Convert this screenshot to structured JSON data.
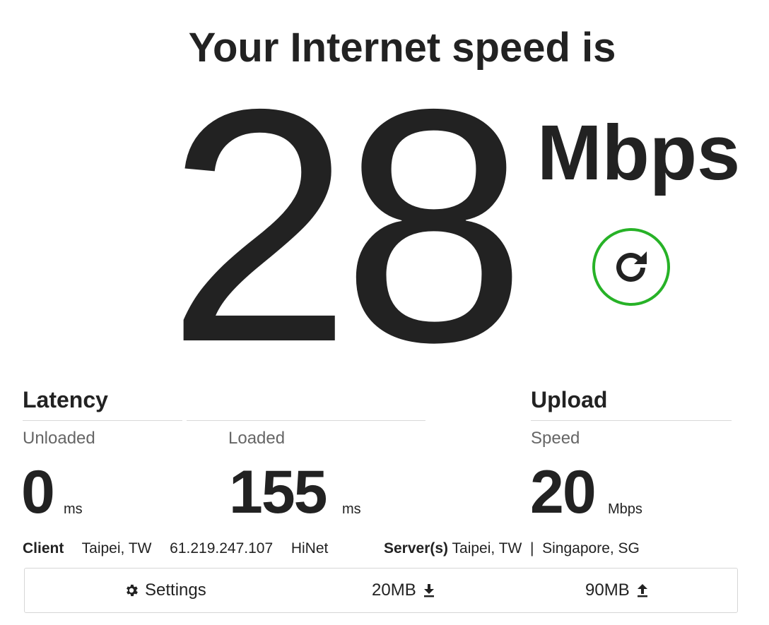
{
  "header": {
    "title": "Your Internet speed is"
  },
  "download": {
    "value": "28",
    "unit": "Mbps"
  },
  "latency": {
    "title": "Latency",
    "unloaded": {
      "label": "Unloaded",
      "value": "0",
      "unit": "ms"
    },
    "loaded": {
      "label": "Loaded",
      "value": "155",
      "unit": "ms"
    }
  },
  "upload": {
    "title": "Upload",
    "speed": {
      "label": "Speed",
      "value": "20",
      "unit": "Mbps"
    }
  },
  "client": {
    "label": "Client",
    "location": "Taipei, TW",
    "ip": "61.219.247.107",
    "isp": "HiNet"
  },
  "servers": {
    "label": "Server(s)",
    "list": "Taipei, TW  |  Singapore, SG"
  },
  "toolbar": {
    "settings_label": "Settings",
    "download_size": "20MB",
    "upload_size": "90MB"
  },
  "icons": {
    "refresh": "refresh-icon",
    "settings": "gear-icon",
    "download": "download-arrow-icon",
    "upload": "upload-arrow-icon"
  },
  "colors": {
    "accent": "#27b227",
    "text": "#222222",
    "muted": "#666666"
  }
}
